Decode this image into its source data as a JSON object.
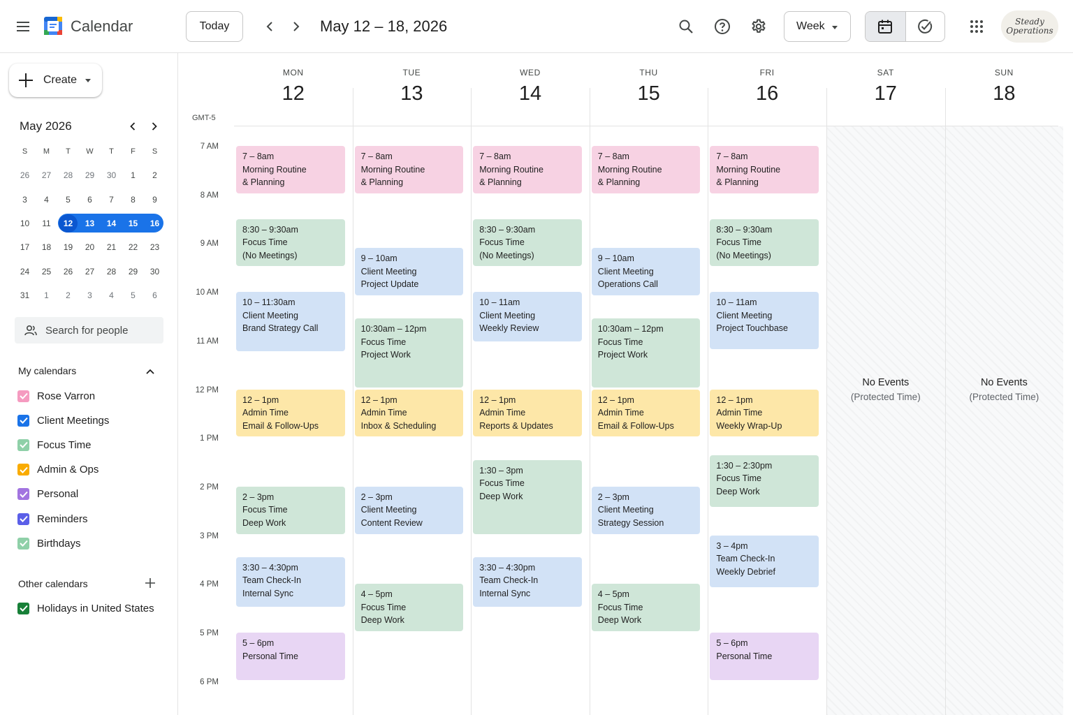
{
  "header": {
    "app_title": "Calendar",
    "today_label": "Today",
    "date_range": "May 12 – 18, 2026",
    "view_label": "Week",
    "brand_line1": "Steady",
    "brand_line2": "Operations",
    "icons": {
      "menu": "hamburger-menu-icon",
      "prev": "chevron-left-icon",
      "next": "chevron-right-icon",
      "search": "search-icon",
      "help": "help-circle-icon",
      "settings": "gear-icon",
      "calendar_view": "calendar-icon",
      "tasks_view": "check-circle-icon",
      "apps": "apps-grid-icon"
    }
  },
  "sidebar": {
    "create_label": "Create",
    "mini_month_title": "May 2026",
    "weekday_initials": [
      "S",
      "M",
      "T",
      "W",
      "T",
      "F",
      "S"
    ],
    "weeks": [
      [
        "26",
        "27",
        "28",
        "29",
        "30",
        "1",
        "2"
      ],
      [
        "3",
        "4",
        "5",
        "6",
        "7",
        "8",
        "9"
      ],
      [
        "10",
        "11",
        "12",
        "13",
        "14",
        "15",
        "16"
      ],
      [
        "17",
        "18",
        "19",
        "20",
        "21",
        "22",
        "23"
      ],
      [
        "24",
        "25",
        "26",
        "27",
        "28",
        "29",
        "30"
      ],
      [
        "31",
        "1",
        "2",
        "3",
        "4",
        "5",
        "6"
      ]
    ],
    "search_people_placeholder": "Search for people",
    "my_calendars_title": "My calendars",
    "my_calendars": [
      {
        "name": "Rose Varron",
        "color": "#f59bc0"
      },
      {
        "name": "Client Meetings",
        "color": "#1a73e8"
      },
      {
        "name": "Focus Time",
        "color": "#8fd0a8"
      },
      {
        "name": "Admin & Ops",
        "color": "#f9ab00"
      },
      {
        "name": "Personal",
        "color": "#a274e0"
      },
      {
        "name": "Reminders",
        "color": "#5b5fe8"
      },
      {
        "name": "Birthdays",
        "color": "#8fd0a8"
      }
    ],
    "other_calendars_title": "Other calendars",
    "other_calendars": [
      {
        "name": "Holidays in United States",
        "color": "#188038"
      }
    ]
  },
  "grid": {
    "timezone": "GMT-5",
    "hours": [
      "7 AM",
      "8 AM",
      "9 AM",
      "10 AM",
      "11 AM",
      "12 PM",
      "1 PM",
      "2 PM",
      "3 PM",
      "4 PM",
      "5 PM",
      "6 PM"
    ],
    "days": [
      {
        "dow": "MON",
        "date": "12"
      },
      {
        "dow": "TUE",
        "date": "13"
      },
      {
        "dow": "WED",
        "date": "14"
      },
      {
        "dow": "THU",
        "date": "15"
      },
      {
        "dow": "FRI",
        "date": "16"
      },
      {
        "dow": "SAT",
        "date": "17"
      },
      {
        "dow": "SUN",
        "date": "18"
      }
    ],
    "weekend_message": "No Events",
    "weekend_submessage": "(Protected Time)",
    "colors": {
      "pink": "#f7d2e3",
      "green": "#cfe6d8",
      "blue": "#d2e2f6",
      "yellow": "#fde7a8",
      "purple": "#e8d6f4"
    },
    "events": [
      {
        "day": 0,
        "start": 7,
        "end": 8,
        "time": "7 – 8am",
        "title": "Morning Routine",
        "subtitle": "& Planning",
        "color": "pink"
      },
      {
        "day": 0,
        "start": 8.5,
        "end": 9.5,
        "time": "8:30 – 9:30am",
        "title": "Focus Time",
        "subtitle": "(No Meetings)",
        "color": "green"
      },
      {
        "day": 0,
        "start": 10,
        "end": 11.25,
        "time": "10 – 11:30am",
        "title": "Client Meeting",
        "subtitle": "Brand Strategy Call",
        "color": "blue"
      },
      {
        "day": 0,
        "start": 12,
        "end": 13,
        "time": "12 – 1pm",
        "title": "Admin Time",
        "subtitle": "Email & Follow-Ups",
        "color": "yellow"
      },
      {
        "day": 0,
        "start": 14,
        "end": 15,
        "time": "2 – 3pm",
        "title": "Focus Time",
        "subtitle": "Deep Work",
        "color": "green"
      },
      {
        "day": 0,
        "start": 15.45,
        "end": 16.5,
        "time": "3:30 – 4:30pm",
        "title": "Team Check-In",
        "subtitle": "Internal Sync",
        "color": "blue"
      },
      {
        "day": 0,
        "start": 17,
        "end": 18,
        "time": "5 – 6pm",
        "title": "Personal Time",
        "subtitle": "",
        "color": "purple"
      },
      {
        "day": 1,
        "start": 7,
        "end": 8,
        "time": "7 – 8am",
        "title": "Morning Routine",
        "subtitle": "& Planning",
        "color": "pink"
      },
      {
        "day": 1,
        "start": 9.1,
        "end": 10.1,
        "time": "9 – 10am",
        "title": "Client Meeting",
        "subtitle": "Project Update",
        "color": "blue"
      },
      {
        "day": 1,
        "start": 10.55,
        "end": 12,
        "time": "10:30am – 12pm",
        "title": "Focus Time",
        "subtitle": "Project Work",
        "color": "green"
      },
      {
        "day": 1,
        "start": 12,
        "end": 13,
        "time": "12 – 1pm",
        "title": "Admin Time",
        "subtitle": "Inbox & Scheduling",
        "color": "yellow"
      },
      {
        "day": 1,
        "start": 14,
        "end": 15,
        "time": "2 – 3pm",
        "title": "Client Meeting",
        "subtitle": "Content Review",
        "color": "blue"
      },
      {
        "day": 1,
        "start": 16,
        "end": 17,
        "time": "4 – 5pm",
        "title": "Focus Time",
        "subtitle": "Deep Work",
        "color": "green"
      },
      {
        "day": 2,
        "start": 7,
        "end": 8,
        "time": "7 – 8am",
        "title": "Morning Routine",
        "subtitle": "& Planning",
        "color": "pink"
      },
      {
        "day": 2,
        "start": 8.5,
        "end": 9.5,
        "time": "8:30 – 9:30am",
        "title": "Focus Time",
        "subtitle": "(No Meetings)",
        "color": "green"
      },
      {
        "day": 2,
        "start": 10,
        "end": 11.05,
        "time": "10 – 11am",
        "title": "Client Meeting",
        "subtitle": "Weekly Review",
        "color": "blue"
      },
      {
        "day": 2,
        "start": 12,
        "end": 13,
        "time": "12 – 1pm",
        "title": "Admin Time",
        "subtitle": "Reports & Updates",
        "color": "yellow"
      },
      {
        "day": 2,
        "start": 13.45,
        "end": 15,
        "time": "1:30 – 3pm",
        "title": "Focus Time",
        "subtitle": "Deep Work",
        "color": "green"
      },
      {
        "day": 2,
        "start": 15.45,
        "end": 16.5,
        "time": "3:30 – 4:30pm",
        "title": "Team Check-In",
        "subtitle": "Internal Sync",
        "color": "blue"
      },
      {
        "day": 3,
        "start": 7,
        "end": 8,
        "time": "7 – 8am",
        "title": "Morning Routine",
        "subtitle": "& Planning",
        "color": "pink"
      },
      {
        "day": 3,
        "start": 9.1,
        "end": 10.1,
        "time": "9 – 10am",
        "title": "Client Meeting",
        "subtitle": "Operations Call",
        "color": "blue"
      },
      {
        "day": 3,
        "start": 10.55,
        "end": 12,
        "time": "10:30am – 12pm",
        "title": "Focus Time",
        "subtitle": "Project Work",
        "color": "green"
      },
      {
        "day": 3,
        "start": 12,
        "end": 13,
        "time": "12 – 1pm",
        "title": "Admin Time",
        "subtitle": "Email & Follow-Ups",
        "color": "yellow"
      },
      {
        "day": 3,
        "start": 14,
        "end": 15,
        "time": "2 – 3pm",
        "title": "Client Meeting",
        "subtitle": "Strategy Session",
        "color": "blue"
      },
      {
        "day": 3,
        "start": 16,
        "end": 17,
        "time": "4 – 5pm",
        "title": "Focus Time",
        "subtitle": "Deep Work",
        "color": "green"
      },
      {
        "day": 4,
        "start": 7,
        "end": 8,
        "time": "7 – 8am",
        "title": "Morning Routine",
        "subtitle": "& Planning",
        "color": "pink"
      },
      {
        "day": 4,
        "start": 8.5,
        "end": 9.5,
        "time": "8:30 – 9:30am",
        "title": "Focus Time",
        "subtitle": "(No Meetings)",
        "color": "green"
      },
      {
        "day": 4,
        "start": 10,
        "end": 11.2,
        "time": "10 – 11am",
        "title": "Client Meeting",
        "subtitle": "Project Touchbase",
        "color": "blue"
      },
      {
        "day": 4,
        "start": 12,
        "end": 13,
        "time": "12 – 1pm",
        "title": "Admin Time",
        "subtitle": "Weekly Wrap-Up",
        "color": "yellow"
      },
      {
        "day": 4,
        "start": 13.35,
        "end": 14.45,
        "time": "1:30 – 2:30pm",
        "title": "Focus Time",
        "subtitle": "Deep Work",
        "color": "green"
      },
      {
        "day": 4,
        "start": 15,
        "end": 16.1,
        "time": "3 – 4pm",
        "title": "Team Check-In",
        "subtitle": "Weekly Debrief",
        "color": "blue"
      },
      {
        "day": 4,
        "start": 17,
        "end": 18,
        "time": "5 – 6pm",
        "title": "Personal Time",
        "subtitle": "",
        "color": "purple"
      }
    ]
  }
}
